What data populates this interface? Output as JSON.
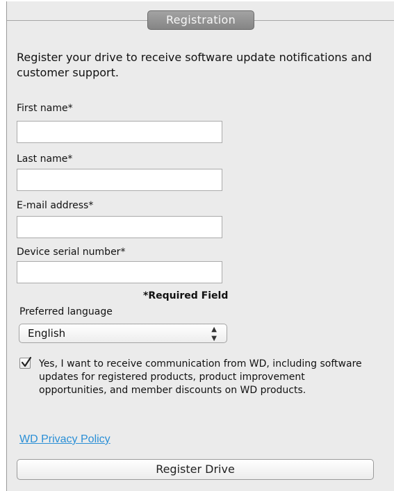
{
  "panel": {
    "tab_title": "Registration"
  },
  "intro_text": "Register your drive to receive software update notifications and customer support.",
  "fields": {
    "first_name": {
      "label": "First name*",
      "value": ""
    },
    "last_name": {
      "label": "Last name*",
      "value": ""
    },
    "email": {
      "label": "E-mail address*",
      "value": ""
    },
    "serial": {
      "label": "Device serial number*",
      "value": ""
    }
  },
  "required_note": "*Required Field",
  "language": {
    "label": "Preferred language",
    "selected": "English"
  },
  "consent": {
    "checked": true,
    "text": "Yes, I want to receive communication from WD, including software updates for registered products, product improvement opportunities, and member discounts on WD products."
  },
  "privacy_link": "WD Privacy Policy",
  "register_button": "Register Drive",
  "colors": {
    "panel_bg": "#ebebeb",
    "link": "#2a8fd6",
    "tab_bg": "#959595"
  },
  "icons": {
    "checkbox": "checkmark-icon",
    "select": "updown-arrows-icon"
  }
}
